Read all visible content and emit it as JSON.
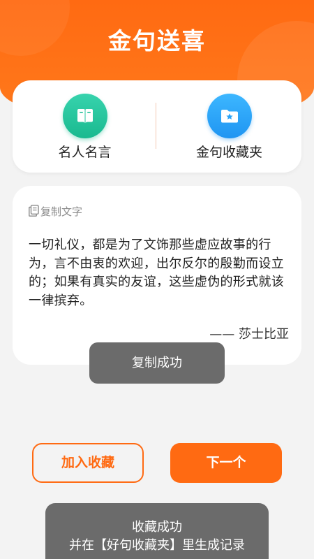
{
  "app": {
    "title": "金句送喜",
    "accent_color": "#ff6a12"
  },
  "entries": [
    {
      "label": "名人名言",
      "icon": "book-icon",
      "color": "#1fbf95"
    },
    {
      "label": "金句收藏夹",
      "icon": "star-folder-icon",
      "color": "#2aa3f8"
    }
  ],
  "quote": {
    "copy_label": "复制文字",
    "text": "一切礼仪，都是为了文饰那些虚应故事的行为，言不由衷的欢迎，出尔反尔的殷勤而设立的；如果有真实的友谊，这些虚伪的形式就该一律摈弃。",
    "author": "—— 莎士比亚"
  },
  "toasts": {
    "copy": "复制成功",
    "favorite_line1": "收藏成功",
    "favorite_line2": "并在【好句收藏夹】里生成记录"
  },
  "actions": {
    "favorite_label": "加入收藏",
    "next_label": "下一个"
  }
}
